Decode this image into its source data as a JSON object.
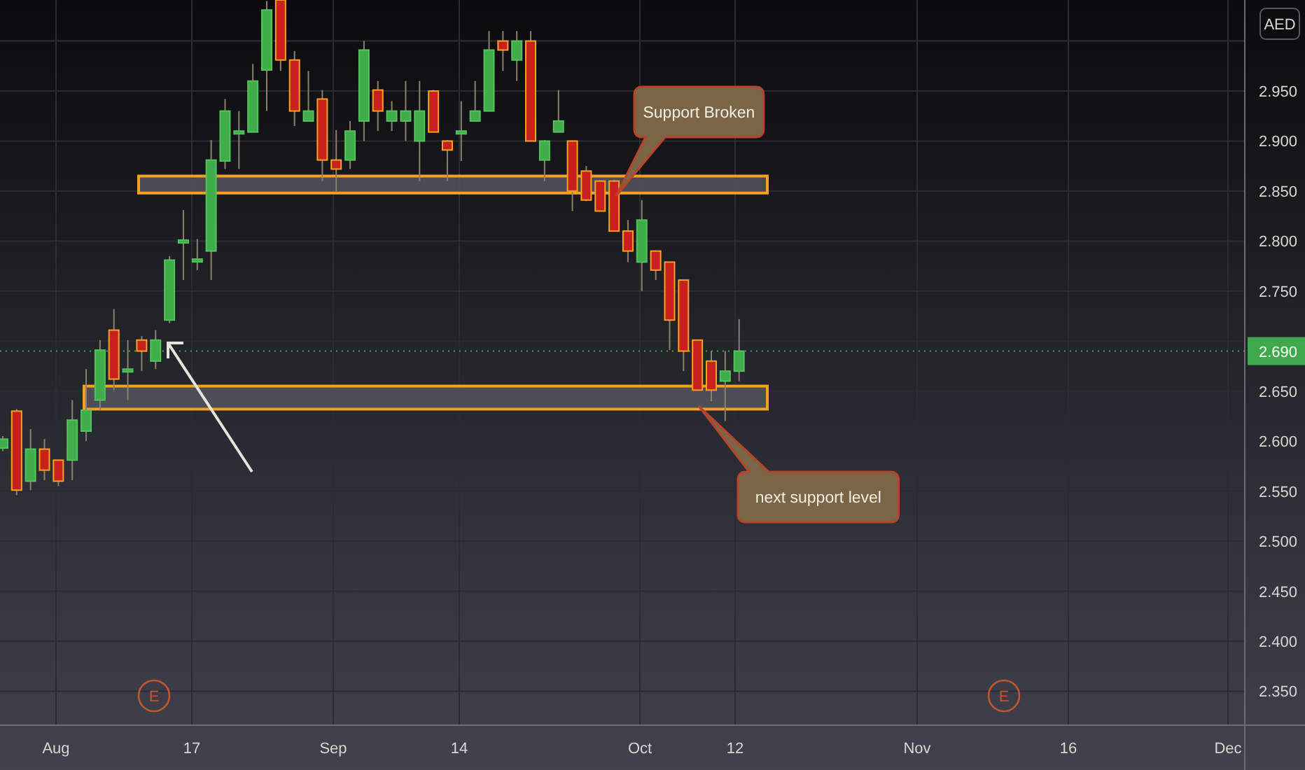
{
  "currency_badge": "AED",
  "price_axis": {
    "labels": [
      "2.950",
      "2.900",
      "2.850",
      "2.800",
      "2.750",
      "2.650",
      "2.600",
      "2.550",
      "2.500",
      "2.450",
      "2.400",
      "2.350"
    ]
  },
  "current_price": {
    "label": "2.690"
  },
  "date_axis": {
    "labels": [
      "Aug",
      "17",
      "Sep",
      "14",
      "Oct",
      "12",
      "Nov",
      "16",
      "Dec"
    ]
  },
  "callouts": [
    {
      "text": "Support Broken"
    },
    {
      "text": "next support level"
    }
  ],
  "earnings_markers": [
    {
      "label": "E"
    },
    {
      "label": "E"
    }
  ]
}
